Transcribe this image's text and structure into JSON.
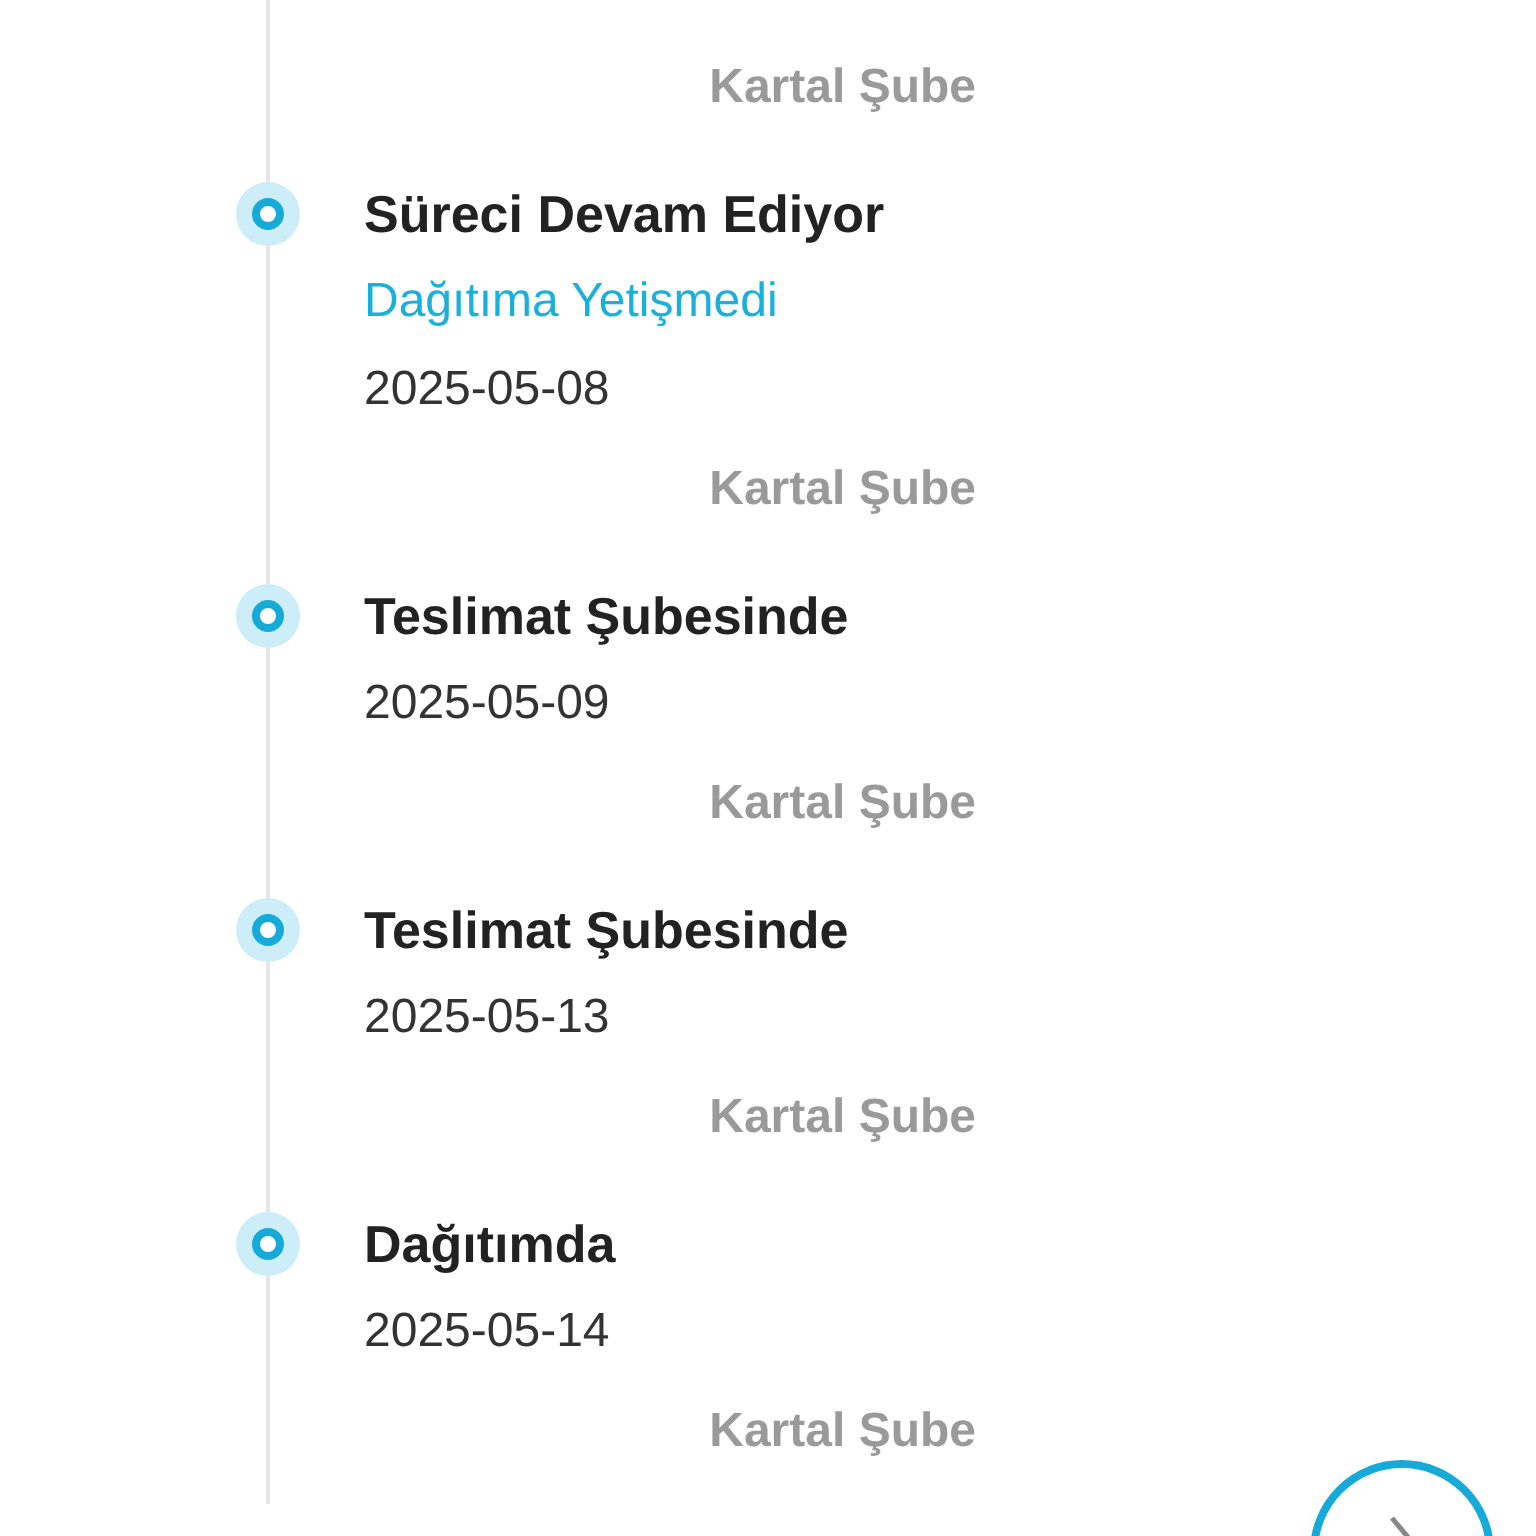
{
  "timeline": {
    "events": [
      {
        "branch": "Kartal Şube"
      },
      {
        "title": "Süreci Devam Ediyor",
        "subtitle": "Dağıtıma Yetişmedi",
        "date": "2025-05-08",
        "branch": "Kartal Şube"
      },
      {
        "title": "Teslimat Şubesinde",
        "date": "2025-05-09",
        "branch": "Kartal Şube"
      },
      {
        "title": "Teslimat Şubesinde",
        "date": "2025-05-13",
        "branch": "Kartal Şube"
      },
      {
        "title": "Dağıtımda",
        "date": "2025-05-14",
        "branch": "Kartal Şube"
      }
    ]
  }
}
